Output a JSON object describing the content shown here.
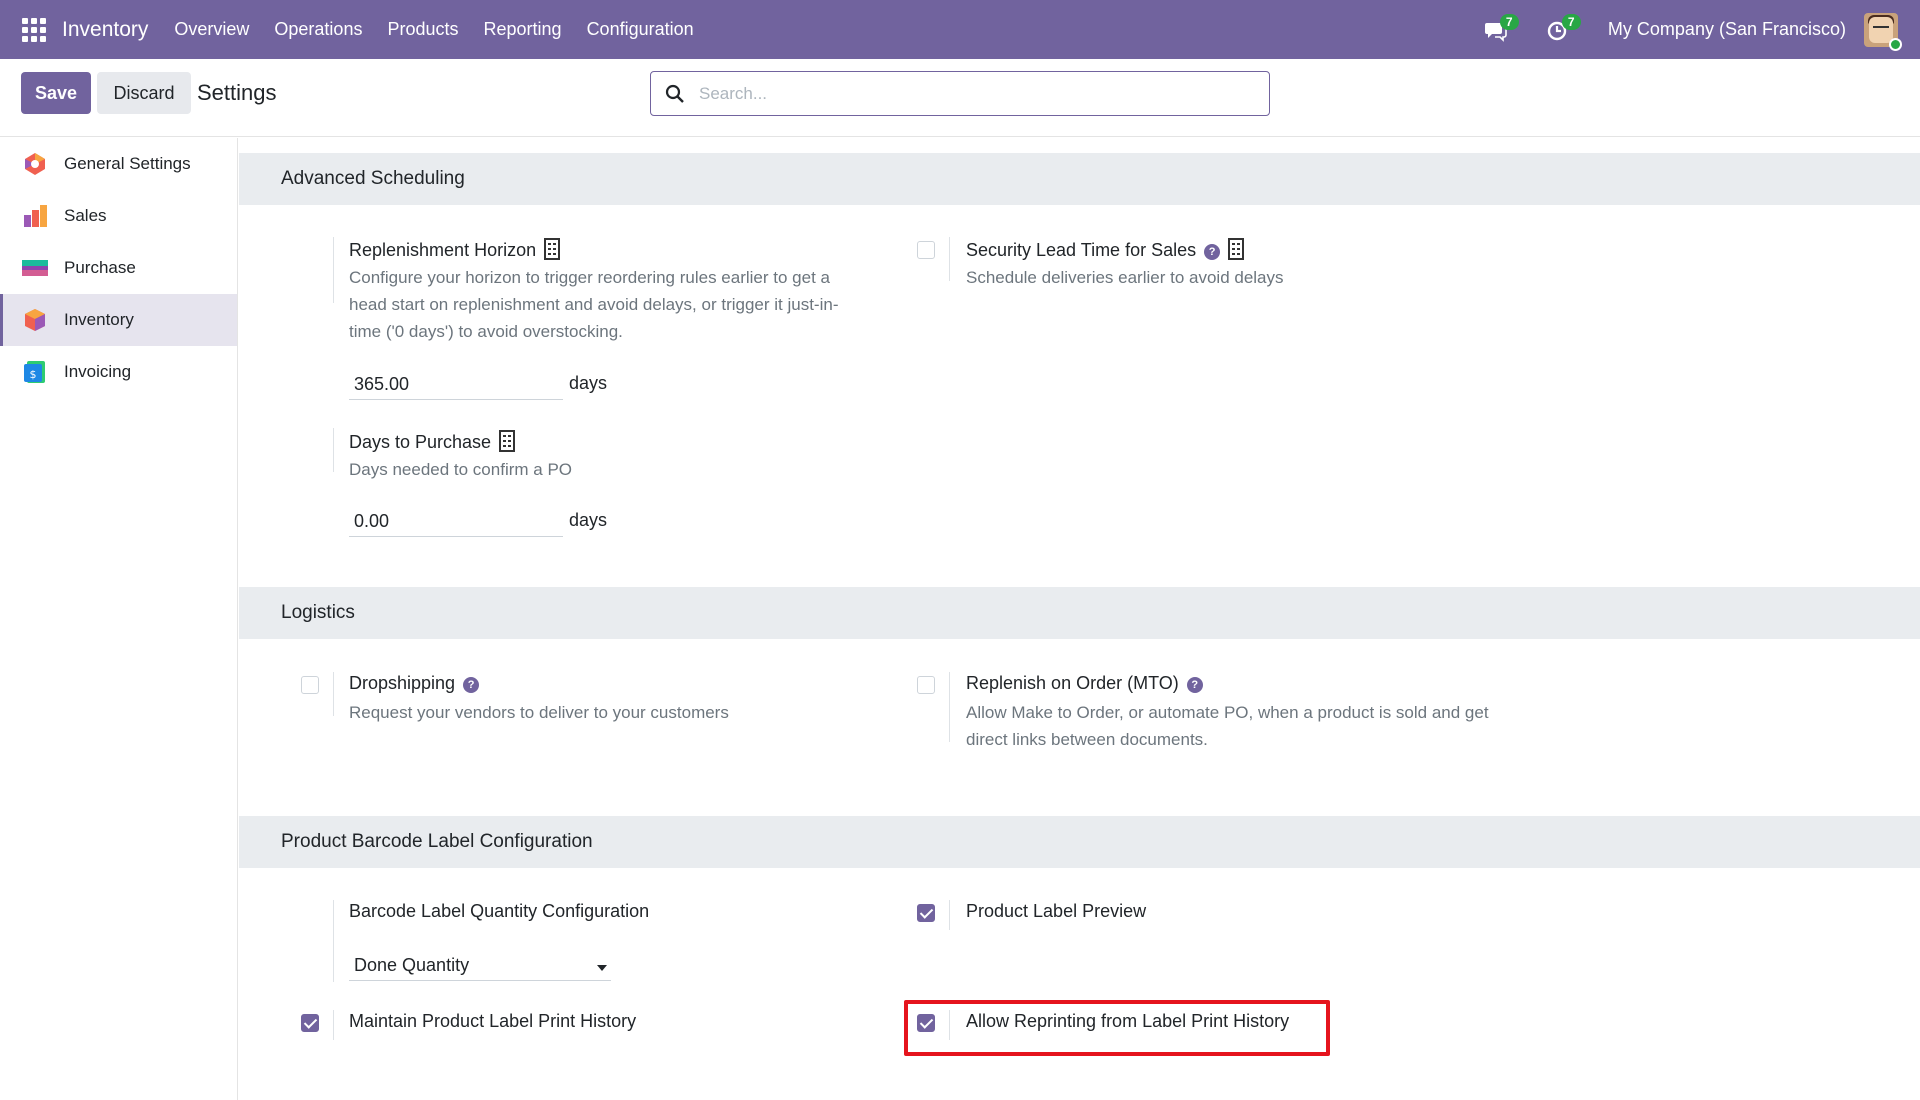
{
  "navbar": {
    "app_name": "Inventory",
    "menu": [
      "Overview",
      "Operations",
      "Products",
      "Reporting",
      "Configuration"
    ],
    "messages_count": "7",
    "activities_count": "7",
    "company": "My Company (San Francisco)"
  },
  "control_panel": {
    "save_label": "Save",
    "discard_label": "Discard",
    "title": "Settings",
    "search_placeholder": "Search..."
  },
  "sidebar": {
    "items": [
      {
        "label": "General Settings",
        "icon": "general-settings-icon"
      },
      {
        "label": "Sales",
        "icon": "sales-icon"
      },
      {
        "label": "Purchase",
        "icon": "purchase-icon"
      },
      {
        "label": "Inventory",
        "icon": "inventory-icon",
        "active": true
      },
      {
        "label": "Invoicing",
        "icon": "invoicing-icon"
      }
    ]
  },
  "sections": {
    "advanced_scheduling": {
      "title": "Advanced Scheduling",
      "replenishment_horizon": {
        "title": "Replenishment Horizon",
        "desc": "Configure your horizon to trigger reordering rules earlier to get a head start on replenishment and avoid delays, or trigger it just-in-time ('0 days') to avoid overstocking.",
        "value": "365.00",
        "unit": "days"
      },
      "security_lead_time": {
        "title": "Security Lead Time for Sales",
        "desc": "Schedule deliveries earlier to avoid delays",
        "checked": false
      },
      "days_to_purchase": {
        "title": "Days to Purchase",
        "desc": "Days needed to confirm a PO",
        "value": "0.00",
        "unit": "days"
      }
    },
    "logistics": {
      "title": "Logistics",
      "dropshipping": {
        "title": "Dropshipping",
        "desc": "Request your vendors to deliver to your customers",
        "checked": false
      },
      "mto": {
        "title": "Replenish on Order (MTO)",
        "desc": "Allow Make to Order, or automate PO, when a product is sold and get direct links between documents.",
        "checked": false
      }
    },
    "barcode_label": {
      "title": "Product Barcode Label Configuration",
      "quantity_config": {
        "title": "Barcode Label Quantity Configuration",
        "selected": "Done Quantity"
      },
      "label_preview": {
        "title": "Product Label Preview",
        "checked": true
      },
      "print_history": {
        "title": "Maintain Product Label Print History",
        "checked": true
      },
      "allow_reprinting": {
        "title": "Allow Reprinting from Label Print History",
        "checked": true
      }
    }
  },
  "colors": {
    "brand": "#71639e",
    "highlight": "#e5141d",
    "badge": "#28a745"
  }
}
